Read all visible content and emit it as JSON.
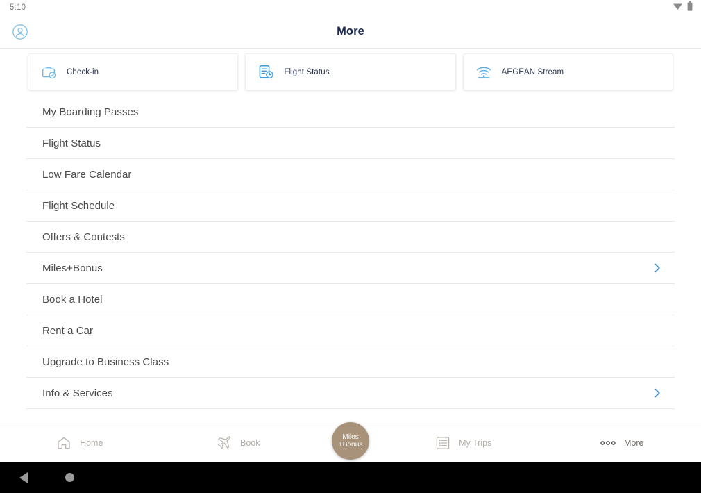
{
  "colors": {
    "accent_blue": "#5ba9dd",
    "title_navy": "#1d2b52",
    "fab_bronze": "#a8937a",
    "row_text": "#4a4a4a",
    "chevron": "#3f8fd0"
  },
  "statusbar": {
    "time": "5:10",
    "wifi_icon": "wifi-icon",
    "battery_icon": "battery-icon"
  },
  "header": {
    "title": "More",
    "profile_icon": "account-circle-icon"
  },
  "quick_actions": [
    {
      "label": "Check-in",
      "icon": "suitcase-check-icon"
    },
    {
      "label": "Flight Status",
      "icon": "document-clock-icon"
    },
    {
      "label": "AEGEAN Stream",
      "icon": "wifi-stream-icon"
    }
  ],
  "menu": {
    "items": [
      {
        "label": "My Boarding Passes",
        "chevron": false
      },
      {
        "label": "Flight Status",
        "chevron": false
      },
      {
        "label": "Low Fare Calendar",
        "chevron": false
      },
      {
        "label": "Flight Schedule",
        "chevron": false
      },
      {
        "label": "Offers & Contests",
        "chevron": false
      },
      {
        "label": "Miles+Bonus",
        "chevron": true
      },
      {
        "label": "Book a Hotel",
        "chevron": false
      },
      {
        "label": "Rent a Car",
        "chevron": false
      },
      {
        "label": "Upgrade to Business Class",
        "chevron": false
      },
      {
        "label": "Info & Services",
        "chevron": true
      }
    ]
  },
  "bottom_nav": {
    "items": [
      {
        "label": "Home",
        "icon": "home-icon",
        "active": false
      },
      {
        "label": "Book",
        "icon": "airplane-icon",
        "active": false
      },
      {
        "label": "My Trips",
        "icon": "list-icon",
        "active": false
      },
      {
        "label": "More",
        "icon": "ellipsis-icon",
        "active": true
      }
    ],
    "fab": {
      "line1": "Miles",
      "line2": "+Bonus",
      "icon": "miles-bonus-badge"
    }
  },
  "system_nav": {
    "back_icon": "back-triangle-icon",
    "home_icon": "home-circle-icon"
  }
}
